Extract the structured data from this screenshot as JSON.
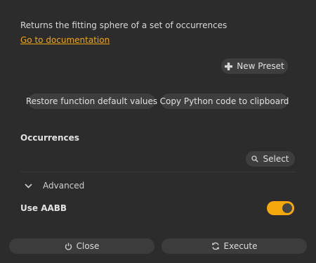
{
  "description": "Returns the fitting sphere of a set of occurrences",
  "doc_link": "Go to documentation",
  "toolbar": {
    "new_preset_label": "New Preset",
    "restore_label": "Restore function default values",
    "copy_label": "Copy Python code to clipboard"
  },
  "occurrences": {
    "label": "Occurrences",
    "select_label": "Select"
  },
  "advanced": {
    "label": "Advanced",
    "expanded": false
  },
  "use_aabb": {
    "label": "Use AABB",
    "checked": true
  },
  "footer": {
    "close_label": "Close",
    "execute_label": "Execute"
  },
  "icons": {
    "new_preset": "plus-icon",
    "select": "search-icon",
    "advanced": "chevron-down-icon",
    "close": "power-icon",
    "execute": "refresh-icon"
  },
  "colors": {
    "background": "#2c2c2c",
    "accent": "#f5a80c",
    "link": "#f0a70a",
    "button": "#3e3e3e"
  }
}
